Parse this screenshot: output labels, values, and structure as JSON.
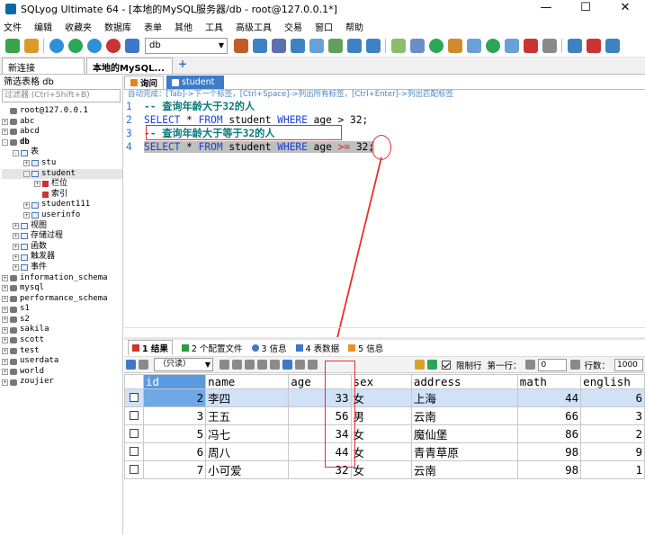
{
  "window": {
    "title": "SQLyog Ultimate 64 - [本地的MySQL服务器/db - root@127.0.0.1*]",
    "minimize": "—",
    "maximize": "☐",
    "close": "✕"
  },
  "menu": [
    "文件",
    "编辑",
    "收藏夹",
    "数据库",
    "表单",
    "其他",
    "工具",
    "高级工具",
    "交易",
    "窗口",
    "帮助"
  ],
  "toolbar": {
    "db_selector": "db"
  },
  "connection_tabs": {
    "new_conn": "新连接",
    "active": "本地的MySQL...",
    "add": "+"
  },
  "left": {
    "filter_label": "筛选表格 db",
    "filter_placeholder": "过滤器 (Ctrl+Shift+B)",
    "tree": [
      {
        "label": "root@127.0.0.1",
        "indent": 0,
        "pm": "",
        "icon": "db"
      },
      {
        "label": "abc",
        "indent": 0,
        "pm": "+",
        "icon": "db"
      },
      {
        "label": "abcd",
        "indent": 0,
        "pm": "+",
        "icon": "db"
      },
      {
        "label": "db",
        "indent": 0,
        "pm": "-",
        "icon": "db",
        "bold": true
      },
      {
        "label": "表",
        "indent": 1,
        "pm": "-",
        "icon": "tbl"
      },
      {
        "label": "stu",
        "indent": 2,
        "pm": "+",
        "icon": "tbl"
      },
      {
        "label": "student",
        "indent": 2,
        "pm": "-",
        "icon": "tbl",
        "selected": true
      },
      {
        "label": "栏位",
        "indent": 3,
        "pm": "+",
        "icon": "col"
      },
      {
        "label": "索引",
        "indent": 3,
        "pm": "",
        "icon": "col"
      },
      {
        "label": "student111",
        "indent": 2,
        "pm": "+",
        "icon": "tbl"
      },
      {
        "label": "userinfo",
        "indent": 2,
        "pm": "+",
        "icon": "tbl"
      },
      {
        "label": "视图",
        "indent": 1,
        "pm": "+",
        "icon": "tbl"
      },
      {
        "label": "存储过程",
        "indent": 1,
        "pm": "+",
        "icon": "tbl"
      },
      {
        "label": "函数",
        "indent": 1,
        "pm": "+",
        "icon": "tbl"
      },
      {
        "label": "触发器",
        "indent": 1,
        "pm": "+",
        "icon": "tbl"
      },
      {
        "label": "事件",
        "indent": 1,
        "pm": "+",
        "icon": "tbl"
      },
      {
        "label": "information_schema",
        "indent": 0,
        "pm": "+",
        "icon": "db"
      },
      {
        "label": "mysql",
        "indent": 0,
        "pm": "+",
        "icon": "db"
      },
      {
        "label": "performance_schema",
        "indent": 0,
        "pm": "+",
        "icon": "db"
      },
      {
        "label": "s1",
        "indent": 0,
        "pm": "+",
        "icon": "db"
      },
      {
        "label": "s2",
        "indent": 0,
        "pm": "+",
        "icon": "db"
      },
      {
        "label": "sakila",
        "indent": 0,
        "pm": "+",
        "icon": "db"
      },
      {
        "label": "scott",
        "indent": 0,
        "pm": "+",
        "icon": "db"
      },
      {
        "label": "test",
        "indent": 0,
        "pm": "+",
        "icon": "db"
      },
      {
        "label": "userdata",
        "indent": 0,
        "pm": "+",
        "icon": "db"
      },
      {
        "label": "world",
        "indent": 0,
        "pm": "+",
        "icon": "db"
      },
      {
        "label": "zoujier",
        "indent": 0,
        "pm": "+",
        "icon": "db"
      }
    ]
  },
  "query_tabs": {
    "query": "询问",
    "student": "student"
  },
  "hint": "自动完成：[Tab]->下一个标签，[Ctrl+Space]->列出所有标签，[Ctrl+Enter]->列出匹配标签",
  "editor": {
    "line1": {
      "num": "1",
      "comment": "-- 查询年龄大于32的人"
    },
    "line2": {
      "num": "2",
      "k1": "SELECT",
      "star": " * ",
      "k2": "FROM",
      "tbl": " student ",
      "k3": "WHERE",
      "rest": " age > 32;"
    },
    "line3": {
      "num": "3",
      "comment": "-- 查询年龄大于等于32的人"
    },
    "line4": {
      "num": "4",
      "k1": "SELECT",
      "star": " * ",
      "k2": "FROM",
      "tbl": " student ",
      "k3": "WHERE",
      "age": " age ",
      "op": ">=",
      "val": " 32;"
    }
  },
  "result_tabs": [
    "1 结果",
    "2 个配置文件",
    "3 信息",
    "4 表数据",
    "5 信息"
  ],
  "grid_toolbar": {
    "mode": "（只读）",
    "limit_label": "限制行",
    "first_label": "第一行：",
    "first_value": "0",
    "rows_label": "行数：",
    "rows_value": "1000"
  },
  "grid": {
    "headers": [
      "id",
      "name",
      "age",
      "sex",
      "address",
      "math",
      "english"
    ],
    "rows": [
      {
        "id": "2",
        "name": "李四",
        "age": "33",
        "sex": "女",
        "address": "上海",
        "math": "44",
        "english": "6"
      },
      {
        "id": "3",
        "name": "王五",
        "age": "56",
        "sex": "男",
        "address": "云南",
        "math": "66",
        "english": "3"
      },
      {
        "id": "5",
        "name": "冯七",
        "age": "34",
        "sex": "女",
        "address": "魔仙堡",
        "math": "86",
        "english": "2"
      },
      {
        "id": "6",
        "name": "周八",
        "age": "44",
        "sex": "女",
        "address": "青青草原",
        "math": "98",
        "english": "9"
      },
      {
        "id": "7",
        "name": "小可爱",
        "age": "32",
        "sex": "女",
        "address": "云南",
        "math": "98",
        "english": "1"
      }
    ]
  },
  "colors": {
    "keyword": "#1a44d6",
    "comment": "#0a7a7a",
    "annotation": "#e53030",
    "selected_row": "#cfe2f8"
  }
}
